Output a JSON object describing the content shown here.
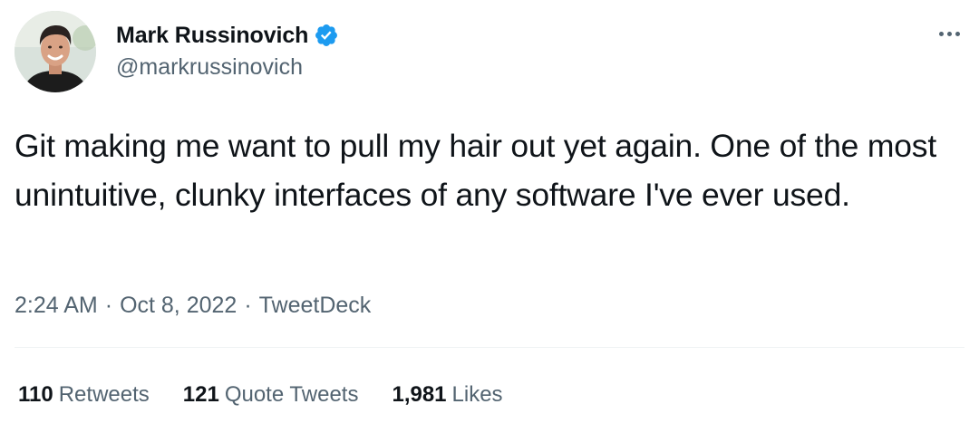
{
  "tweet": {
    "author": {
      "display_name": "Mark Russinovich",
      "handle": "@markrussinovich",
      "verified": true,
      "avatar_icon": "profile-photo"
    },
    "text": "Git making me want to pull my hair out yet again. One of the most unintuitive, clunky interfaces of any software I've ever used.",
    "time": "2:24 AM",
    "separator": "·",
    "date": "Oct 8, 2022",
    "source": "TweetDeck",
    "stats": {
      "retweets": {
        "count": "110",
        "label": "Retweets"
      },
      "quote_tweets": {
        "count": "121",
        "label": "Quote Tweets"
      },
      "likes": {
        "count": "1,981",
        "label": "Likes"
      }
    }
  },
  "colors": {
    "text_primary": "#0f1419",
    "text_secondary": "#536471",
    "verified_badge": "#1d9bf0",
    "divider": "#eff3f4"
  },
  "icons": {
    "verified": "verified-badge-icon",
    "more": "more-options-icon"
  }
}
